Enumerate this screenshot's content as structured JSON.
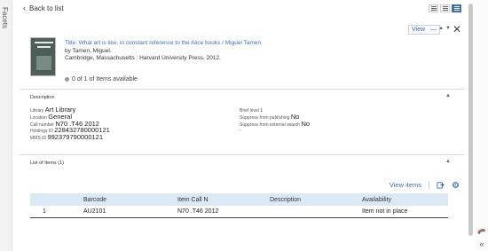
{
  "sidebar": {
    "facets_label": "Facets"
  },
  "header": {
    "back_label": "Back to list"
  },
  "record": {
    "view_label": "View",
    "title_line": "Title: What art is like, in constant reference to the Alice books / Miguel Tamen.",
    "author_line": "by Tamen, Miguel.",
    "publication_line": "Cambridge, Massachusetts : Harvard University Press, 2012.",
    "availability": "0 of 1 of Items available"
  },
  "description": {
    "section_title": "Description",
    "library_label": "Library",
    "library_value": "Art Library",
    "location_label": "Location",
    "location_value": "General",
    "call_number_label": "Call number",
    "call_number_value": "N70 .T46 2012",
    "holdings_id_label": "Holdings ID",
    "holdings_id_value": "228432780000121",
    "mms_id_label": "MMS ID",
    "mms_id_value": "992379790000121",
    "brief_level_label": "Brief level",
    "brief_level_value": "1",
    "suppress_publishing_label": "Suppress from publishing",
    "suppress_publishing_value": "No",
    "suppress_external_label": "Suppress from external search",
    "suppress_external_value": "No",
    "extra_value": "-"
  },
  "items": {
    "section_title": "List of Items (1)",
    "view_items_label": "View items",
    "columns": [
      "",
      "Barcode",
      "Item Call N",
      "Description",
      "Availability"
    ],
    "rows": [
      {
        "index": "1",
        "barcode": "AU2101",
        "call_number": "N70 .T46 2012",
        "description": "",
        "availability": "Item not in place"
      }
    ]
  },
  "colors": {
    "link": "#3b6fb6",
    "table_header": "#dbe9f5",
    "active_toggle": "#3b6fb6"
  }
}
